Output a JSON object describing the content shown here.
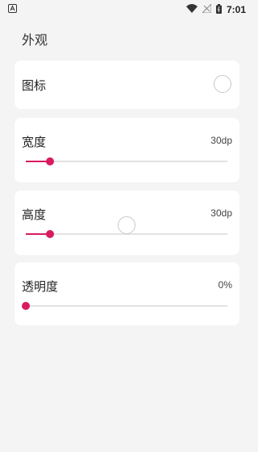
{
  "status_bar": {
    "time": "7:01",
    "icons": [
      "notification-a-icon",
      "wifi-icon",
      "no-signal-icon",
      "battery-icon"
    ]
  },
  "page": {
    "title": "外观"
  },
  "settings": {
    "icon_row": {
      "label": "图标",
      "checked": false
    },
    "width": {
      "label": "宽度",
      "value_text": "30dp",
      "level": 0.12
    },
    "height": {
      "label": "高度",
      "value_text": "30dp",
      "level": 0.12
    },
    "opacity": {
      "label": "透明度",
      "value_text": "0%",
      "level": 0.0
    }
  },
  "colors": {
    "accent": "#d81b60",
    "card": "#ffffff",
    "background": "#f4f4f4",
    "track": "#e2e2e2"
  }
}
